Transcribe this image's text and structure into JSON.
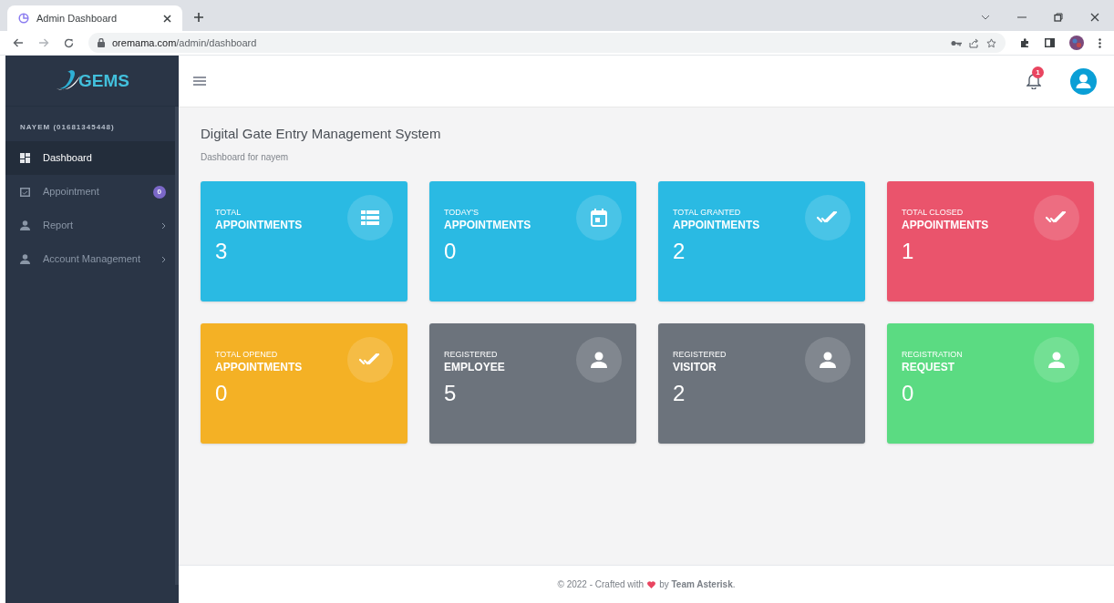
{
  "browser": {
    "tab_title": "Admin Dashboard",
    "url_host": "oremama.com",
    "url_path": "/admin/dashboard"
  },
  "sidebar": {
    "logo_text": "GEMS",
    "user": "NAYEM (01681345448)",
    "items": [
      {
        "label": "Dashboard",
        "kind": "link",
        "selected": true
      },
      {
        "label": "Appointment",
        "kind": "badge",
        "badge": "0",
        "selected": false
      },
      {
        "label": "Report",
        "kind": "submenu",
        "selected": false
      },
      {
        "label": "Account Management",
        "kind": "submenu",
        "selected": false
      }
    ]
  },
  "header": {
    "notification_count": "1"
  },
  "page": {
    "title": "Digital Gate Entry Management System",
    "subtitle": "Dashboard for nayem"
  },
  "cards": [
    {
      "label_top": "TOTAL",
      "label_main": "APPOINTMENTS",
      "value": "3",
      "kind": "list",
      "color": "#2abae3"
    },
    {
      "label_top": "TODAY'S",
      "label_main": "APPOINTMENTS",
      "value": "0",
      "kind": "calendar",
      "color": "#2abae3"
    },
    {
      "label_top": "TOTAL GRANTED",
      "label_main": "APPOINTMENTS",
      "value": "2",
      "kind": "check",
      "color": "#2abae3"
    },
    {
      "label_top": "TOTAL CLOSED",
      "label_main": "APPOINTMENTS",
      "value": "1",
      "kind": "check",
      "color": "#ea546c"
    },
    {
      "label_top": "TOTAL OPENED",
      "label_main": "APPOINTMENTS",
      "value": "0",
      "kind": "check",
      "color": "#f4b125"
    },
    {
      "label_top": "REGISTERED",
      "label_main": "EMPLOYEE",
      "value": "5",
      "kind": "person",
      "color": "#6c737c"
    },
    {
      "label_top": "REGISTERED",
      "label_main": "VISITOR",
      "value": "2",
      "kind": "person",
      "color": "#6c737c"
    },
    {
      "label_top": "REGISTRATION",
      "label_main": "REQUEST",
      "value": "0",
      "kind": "person",
      "color": "#5bdb82"
    }
  ],
  "footer": {
    "before": "© 2022 - Crafted with",
    "after": "by **Team Asterisk**."
  }
}
